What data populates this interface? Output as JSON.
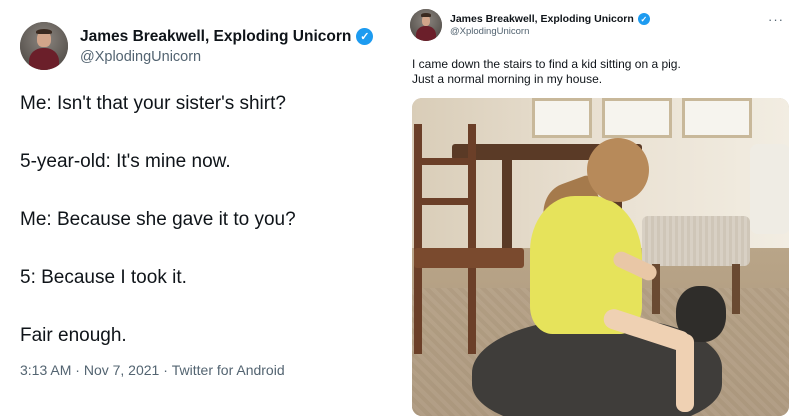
{
  "left_tweet": {
    "author": {
      "name": "James Breakwell, Exploding Unicorn",
      "handle": "@XplodingUnicorn",
      "verified_mark": "✓"
    },
    "lines": [
      "Me: Isn't that your sister's shirt?",
      "5-year-old: It's mine now.",
      "Me: Because she gave it to you?",
      "5: Because I took it.",
      "Fair enough."
    ],
    "meta": {
      "time": "3:13 AM",
      "sep1": " · ",
      "date": "Nov 7, 2021",
      "sep2": " · ",
      "source": "Twitter for Android"
    }
  },
  "right_tweet": {
    "author": {
      "name": "James Breakwell, Exploding Unicorn",
      "handle": "@XplodingUnicorn",
      "verified_mark": "✓"
    },
    "more_icon": "···",
    "text_line1": "I came down the stairs to find a kid sitting on a pig.",
    "text_line2": "Just a normal morning in my house."
  },
  "colors": {
    "text": "#0f1419",
    "secondary": "#536471",
    "verified": "#1d9bf0"
  }
}
